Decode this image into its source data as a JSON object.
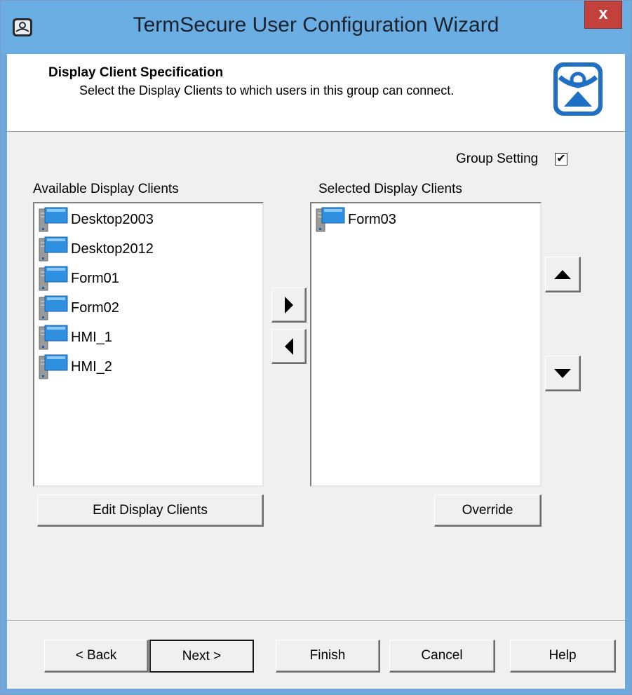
{
  "window": {
    "title": "TermSecure User Configuration Wizard",
    "close_label": "x",
    "colors": {
      "titlebar": "#6aaee3",
      "close": "#c2413a",
      "face": "#f0f0f0"
    }
  },
  "header": {
    "title": "Display Client Specification",
    "subtitle": "Select the Display Clients to which users in this group can connect.",
    "logo_icon": "thinmanager-logo-icon"
  },
  "group_setting": {
    "label": "Group Setting",
    "checked": true,
    "check_glyph": "✔"
  },
  "available": {
    "label": "Available Display Clients",
    "items": [
      {
        "label": "Desktop2003",
        "icon": "display-client-icon"
      },
      {
        "label": "Desktop2012",
        "icon": "display-client-icon"
      },
      {
        "label": "Form01",
        "icon": "display-client-icon"
      },
      {
        "label": "Form02",
        "icon": "display-client-icon"
      },
      {
        "label": "HMI_1",
        "icon": "display-client-icon"
      },
      {
        "label": "HMI_2",
        "icon": "display-client-icon"
      }
    ],
    "edit_button": "Edit Display Clients"
  },
  "selected": {
    "label": "Selected Display Clients",
    "items": [
      {
        "label": "Form03",
        "icon": "display-client-icon"
      }
    ],
    "override_button": "Override"
  },
  "move": {
    "add_icon": "arrow-right-icon",
    "remove_icon": "arrow-left-icon",
    "up_icon": "arrow-up-icon",
    "down_icon": "arrow-down-icon"
  },
  "footer": {
    "back": "< Back",
    "next": "Next >",
    "finish": "Finish",
    "cancel": "Cancel",
    "help": "Help"
  }
}
